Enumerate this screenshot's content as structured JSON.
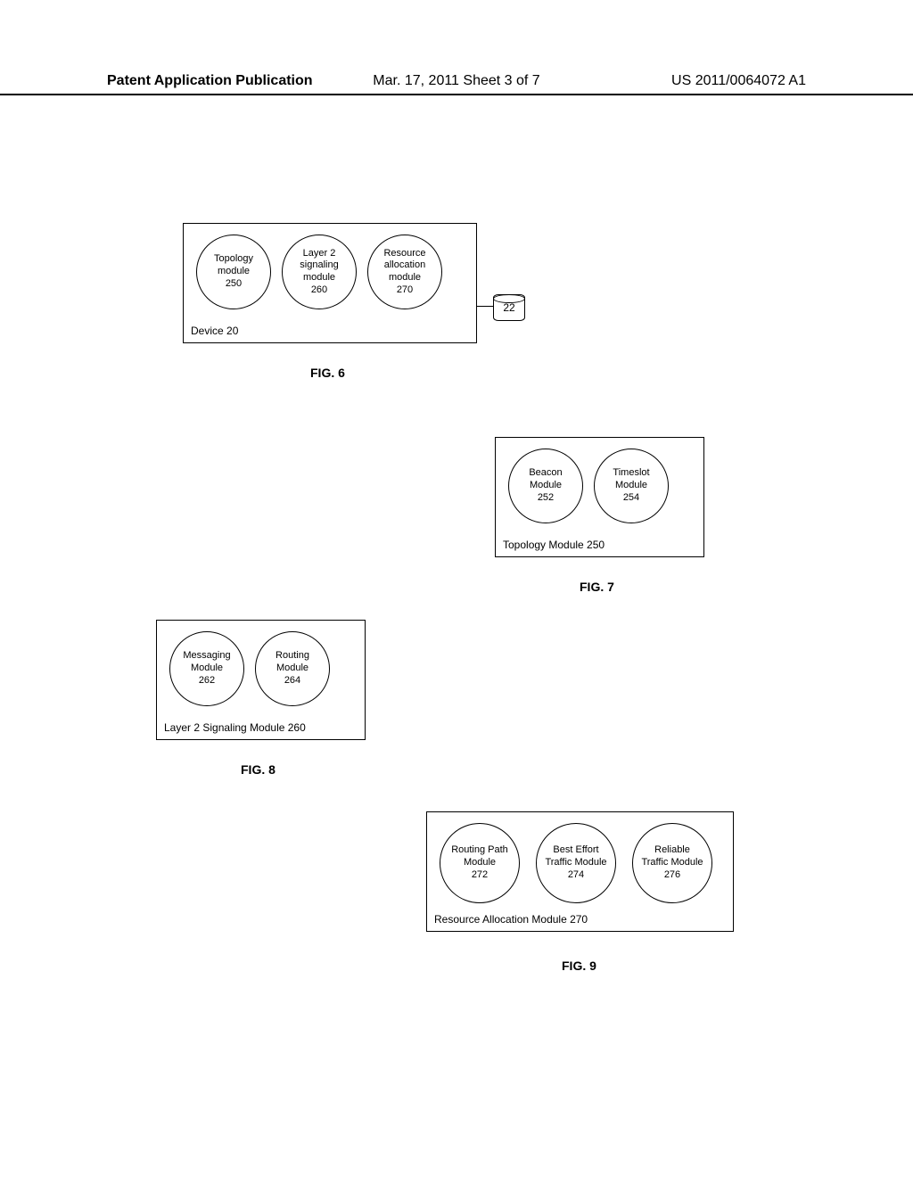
{
  "header": {
    "left": "Patent Application Publication",
    "mid": "Mar. 17, 2011  Sheet 3 of 7",
    "right": "US 2011/0064072 A1"
  },
  "fig6": {
    "box_label": "Device 20",
    "modules": [
      "Topology\nmodule\n250",
      "Layer 2\nsignaling\nmodule\n260",
      "Resource\nallocation\nmodule\n270"
    ],
    "cylinder_label": "22",
    "caption": "FIG. 6"
  },
  "fig7": {
    "box_label": "Topology Module 250",
    "modules": [
      "Beacon\nModule\n252",
      "Timeslot\nModule\n254"
    ],
    "caption": "FIG. 7"
  },
  "fig8": {
    "box_label": "Layer 2 Signaling Module 260",
    "modules": [
      "Messaging\nModule\n262",
      "Routing\nModule\n264"
    ],
    "caption": "FIG. 8"
  },
  "fig9": {
    "box_label": "Resource Allocation Module 270",
    "modules": [
      "Routing Path\nModule\n272",
      "Best Effort\nTraffic Module\n274",
      "Reliable\nTraffic Module\n276"
    ],
    "caption": "FIG. 9"
  }
}
